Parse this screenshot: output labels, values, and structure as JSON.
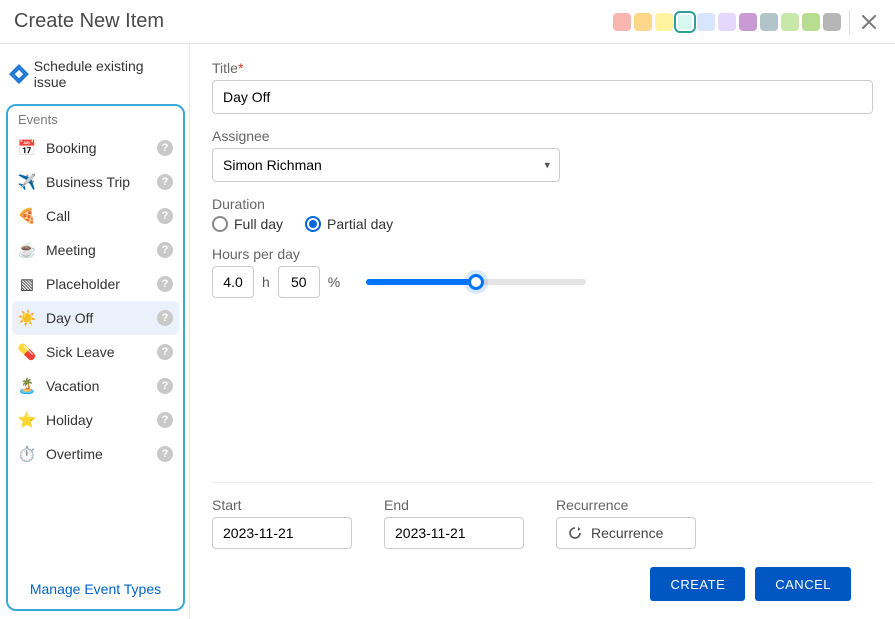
{
  "header": {
    "title": "Create New Item",
    "colors": [
      "#f9b6b0",
      "#ffd78a",
      "#fff3a0",
      "#d7f7f1",
      "#d7e5ff",
      "#e5d7ff",
      "#c99bd4",
      "#b2c4c9",
      "#c7e8a8",
      "#b7dd8f",
      "#b6b6b6"
    ],
    "selected_color_index": 3
  },
  "sidebar": {
    "schedule_existing_label": "Schedule existing issue",
    "events_header": "Events",
    "manage_label": "Manage Event Types",
    "items": [
      {
        "icon": "📅",
        "label": "Booking"
      },
      {
        "icon": "✈️",
        "label": "Business Trip"
      },
      {
        "icon": "🍕",
        "label": "Call"
      },
      {
        "icon": "☕",
        "label": "Meeting"
      },
      {
        "icon": "▧",
        "label": "Placeholder"
      },
      {
        "icon": "☀️",
        "label": "Day Off",
        "selected": true
      },
      {
        "icon": "💊",
        "label": "Sick Leave"
      },
      {
        "icon": "🏝️",
        "label": "Vacation"
      },
      {
        "icon": "⭐",
        "label": "Holiday"
      },
      {
        "icon": "⏱️",
        "label": "Overtime"
      }
    ]
  },
  "form": {
    "title_label": "Title",
    "title_value": "Day Off",
    "assignee_label": "Assignee",
    "assignee_value": "Simon Richman",
    "duration_label": "Duration",
    "full_day_label": "Full day",
    "partial_day_label": "Partial day",
    "partial_selected": true,
    "hours_label": "Hours per day",
    "hours_value": "4.0",
    "hours_unit": "h",
    "percent_value": "50",
    "percent_unit": "%",
    "slider_percent": 50,
    "start_label": "Start",
    "start_value": "2023-11-21",
    "end_label": "End",
    "end_value": "2023-11-21",
    "recurrence_label": "Recurrence",
    "recurrence_btn": "Recurrence"
  },
  "footer": {
    "create": "CREATE",
    "cancel": "CANCEL"
  }
}
